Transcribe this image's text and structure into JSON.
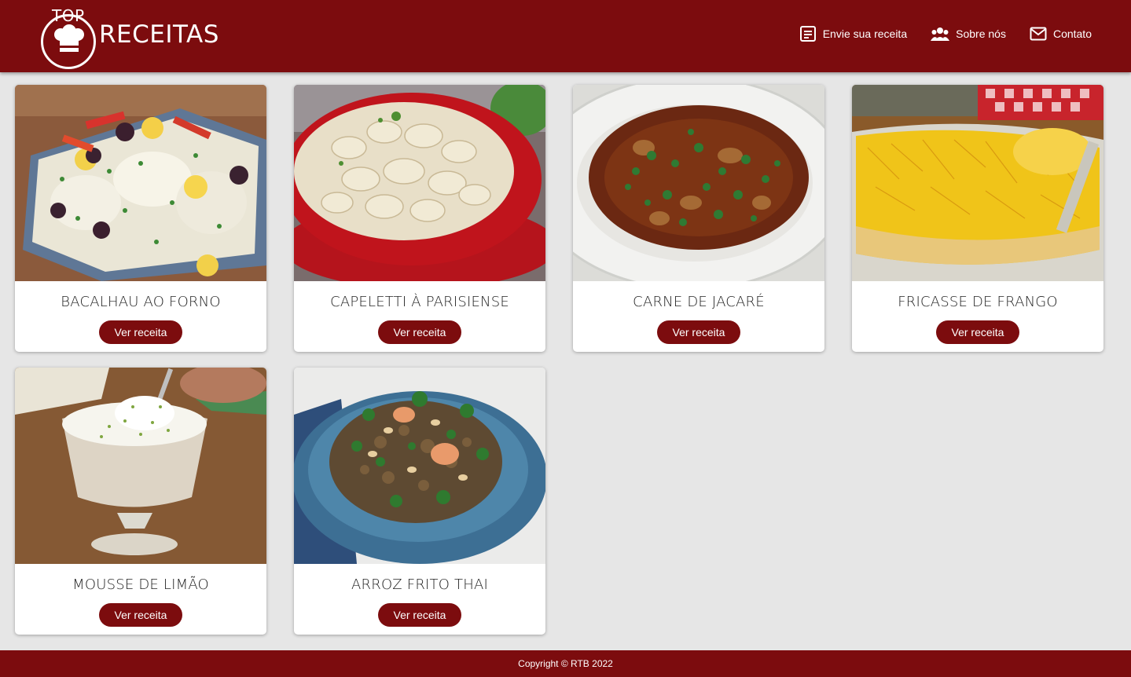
{
  "header": {
    "logo_top": "TOP",
    "logo_main": "RECEITAS",
    "nav": [
      {
        "label": "Envie sua receita",
        "icon": "note-icon"
      },
      {
        "label": "Sobre nós",
        "icon": "users-icon"
      },
      {
        "label": "Contato",
        "icon": "mail-icon"
      }
    ]
  },
  "recipes": [
    {
      "title": "BACALHAU AO FORNO",
      "button": "Ver receita",
      "image": "baked-cod-dish"
    },
    {
      "title": "CAPELETTI À PARISIENSE",
      "button": "Ver receita",
      "image": "capeletti-red-bowl"
    },
    {
      "title": "CARNE DE JACARÉ",
      "button": "Ver receita",
      "image": "alligator-stew-plate"
    },
    {
      "title": "FRICASSE DE FRANGO",
      "button": "Ver receita",
      "image": "chicken-fricasse-dish"
    },
    {
      "title": "MOUSSE DE LIMÃO",
      "button": "Ver receita",
      "image": "lime-mousse-glass"
    },
    {
      "title": "ARROZ FRITO THAI",
      "button": "Ver receita",
      "image": "thai-fried-rice-bowl"
    }
  ],
  "footer": {
    "copyright": "Copyright © RTB 2022"
  },
  "colors": {
    "brand": "#7c0c0e",
    "background": "#e6e6e6"
  }
}
